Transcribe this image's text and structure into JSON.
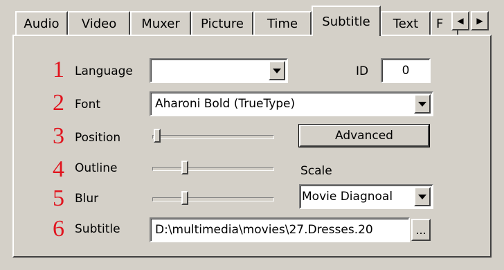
{
  "tabs": [
    {
      "label": "Audio"
    },
    {
      "label": "Video"
    },
    {
      "label": "Muxer"
    },
    {
      "label": "Picture"
    },
    {
      "label": "Time"
    },
    {
      "label": "Subtitle"
    },
    {
      "label": "Text"
    },
    {
      "label": "F"
    }
  ],
  "active_tab": "Subtitle",
  "rows": [
    {
      "num": "1",
      "label": "Language"
    },
    {
      "num": "2",
      "label": "Font"
    },
    {
      "num": "3",
      "label": "Position"
    },
    {
      "num": "4",
      "label": "Outline"
    },
    {
      "num": "5",
      "label": "Blur"
    },
    {
      "num": "6",
      "label": "Subtitle"
    }
  ],
  "language": {
    "value": ""
  },
  "id": {
    "label": "ID",
    "value": "0"
  },
  "font": {
    "value": "Aharoni Bold (TrueType)"
  },
  "position_slider": {
    "level": 0.02
  },
  "outline_slider": {
    "level": 0.28
  },
  "blur_slider": {
    "level": 0.28
  },
  "advanced_button": {
    "label": "Advanced"
  },
  "scale": {
    "label": "Scale",
    "value": "Movie Diagnoal"
  },
  "subtitle_path": {
    "value": "D:\\multimedia\\movies\\27.Dresses.20"
  },
  "browse_button": {
    "label": "..."
  },
  "icons": {
    "tab_left": "triangle-left-icon",
    "tab_right": "triangle-right-icon",
    "dropdown": "triangle-down-icon"
  }
}
